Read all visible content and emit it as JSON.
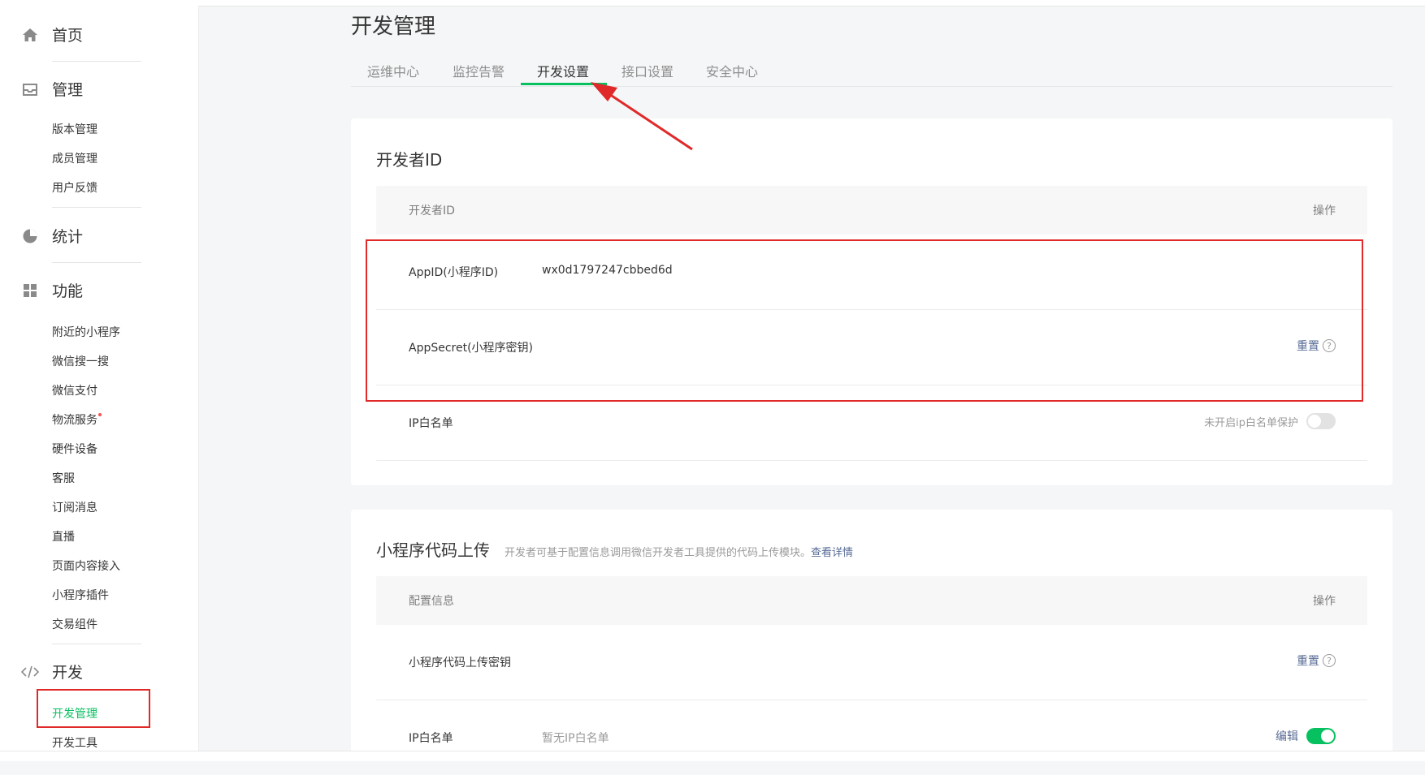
{
  "sidebar": {
    "home": "首页",
    "manage": {
      "label": "管理",
      "items": [
        "版本管理",
        "成员管理",
        "用户反馈"
      ]
    },
    "stats": "统计",
    "features": {
      "label": "功能",
      "items": [
        "附近的小程序",
        "微信搜一搜",
        "微信支付",
        "物流服务",
        "硬件设备",
        "客服",
        "订阅消息",
        "直播",
        "页面内容接入",
        "小程序插件",
        "交易组件"
      ]
    },
    "dev": {
      "label": "开发",
      "items": [
        "开发管理",
        "开发工具"
      ]
    },
    "icons": {
      "home": "home-icon",
      "manage": "inbox-icon",
      "stats": "pie-chart-icon",
      "features": "grid-icon",
      "dev": "code-icon"
    }
  },
  "main": {
    "title": "开发管理",
    "tabs": [
      "运维中心",
      "监控告警",
      "开发设置",
      "接口设置",
      "安全中心"
    ],
    "active_tab": "开发设置",
    "developer_card": {
      "title": "开发者ID",
      "header": {
        "left": "开发者ID",
        "right": "操作"
      },
      "rows": [
        {
          "label": "AppID(小程序ID)",
          "value": "wx0d1797247cbbed6d"
        },
        {
          "label": "AppSecret(小程序密钥)",
          "action": "重置"
        },
        {
          "label": "IP白名单",
          "status": "未开启ip白名单保护",
          "switch_on": false
        }
      ]
    },
    "upload_card": {
      "title": "小程序代码上传",
      "desc": "开发者可基于配置信息调用微信开发者工具提供的代码上传模块。",
      "desc_link": "查看详情",
      "header": {
        "left": "配置信息",
        "right": "操作"
      },
      "rows": [
        {
          "label": "小程序代码上传密钥",
          "action": "重置"
        },
        {
          "label": "IP白名单",
          "value": "暂无IP白名单",
          "action": "编辑",
          "switch_on": true
        }
      ]
    }
  },
  "help_symbol": "?",
  "colors": {
    "accent": "#07c160",
    "link": "#576b95",
    "annotation": "#e02a2a"
  }
}
